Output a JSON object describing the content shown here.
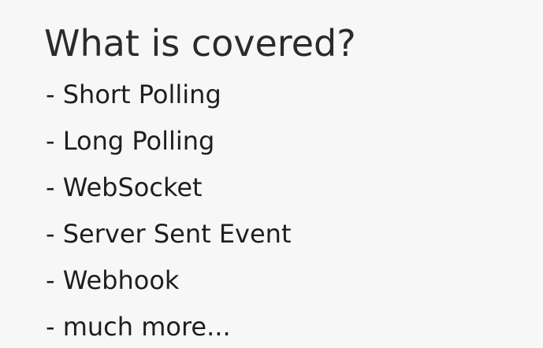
{
  "slide": {
    "title": "What is covered?",
    "items": [
      "- Short Polling",
      "- Long Polling",
      "- WebSocket",
      "- Server Sent Event",
      "- Webhook",
      "- much more..."
    ]
  }
}
